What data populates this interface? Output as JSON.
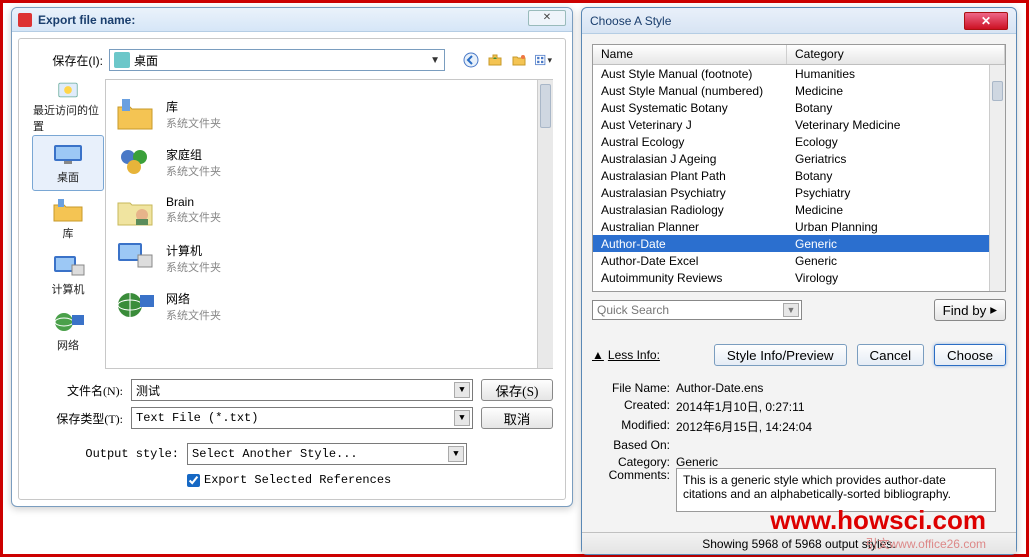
{
  "left_dialog": {
    "title": "Export file name:",
    "save_in_label": "保存在(I):",
    "location": "桌面",
    "toolbar": {
      "back": "back",
      "up": "up",
      "newfolder": "newfolder",
      "views": "views"
    },
    "places": [
      {
        "label": "最近访问的位置"
      },
      {
        "label": "桌面"
      },
      {
        "label": "库"
      },
      {
        "label": "计算机"
      },
      {
        "label": "网络"
      }
    ],
    "items": [
      {
        "name": "库",
        "sub": "系统文件夹"
      },
      {
        "name": "家庭组",
        "sub": "系统文件夹"
      },
      {
        "name": "Brain",
        "sub": "系统文件夹"
      },
      {
        "name": "计算机",
        "sub": "系统文件夹"
      },
      {
        "name": "网络",
        "sub": "系统文件夹"
      }
    ],
    "filename_label": "文件名(N):",
    "filename_value": "测试",
    "filetype_label": "保存类型(T):",
    "filetype_value": "Text File (*.txt)",
    "save_btn": "保存(S)",
    "cancel_btn": "取消",
    "output_style_label": "Output style:",
    "output_style_value": "Select Another Style...",
    "export_selected_label": "Export Selected References"
  },
  "right_dialog": {
    "title": "Choose A Style",
    "col_name": "Name",
    "col_category": "Category",
    "rows": [
      {
        "name": "Aust Style Manual (footnote)",
        "cat": "Humanities"
      },
      {
        "name": "Aust Style Manual (numbered)",
        "cat": "Medicine"
      },
      {
        "name": "Aust Systematic Botany",
        "cat": "Botany"
      },
      {
        "name": "Aust Veterinary J",
        "cat": "Veterinary Medicine"
      },
      {
        "name": "Austral Ecology",
        "cat": "Ecology"
      },
      {
        "name": "Australasian J Ageing",
        "cat": "Geriatrics"
      },
      {
        "name": "Australasian Plant Path",
        "cat": "Botany"
      },
      {
        "name": "Australasian Psychiatry",
        "cat": "Psychiatry"
      },
      {
        "name": "Australasian Radiology",
        "cat": "Medicine"
      },
      {
        "name": "Australian Planner",
        "cat": "Urban Planning"
      },
      {
        "name": "Author-Date",
        "cat": "Generic",
        "selected": true
      },
      {
        "name": "Author-Date Excel",
        "cat": "Generic"
      },
      {
        "name": "Autoimmunity Reviews",
        "cat": "Virology"
      }
    ],
    "quick_search": "Quick Search",
    "find_by": "Find by",
    "less_info": "Less Info:",
    "style_info": "Style Info/Preview",
    "cancel": "Cancel",
    "choose": "Choose",
    "details": {
      "filename_label": "File Name:",
      "filename": "Author-Date.ens",
      "created_label": "Created:",
      "created": "2014年1月10日, 0:27:11",
      "modified_label": "Modified:",
      "modified": "2012年6月15日, 14:24:04",
      "basedon_label": "Based On:",
      "basedon": "",
      "category_label": "Category:",
      "category": "Generic"
    },
    "comments_label": "Comments:",
    "comments": "This is a generic style which provides author-date citations and an alphabetically-sorted bibliography.",
    "status": "Showing 5968 of 5968 output styles."
  },
  "watermark": "www.howsci.com",
  "watermark2": "引文www.office26.com"
}
